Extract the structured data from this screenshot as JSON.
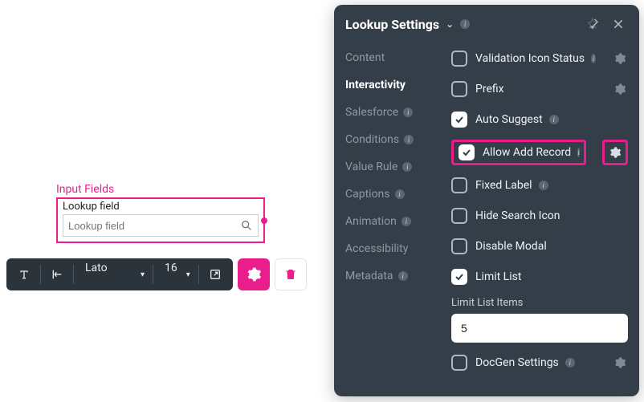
{
  "canvas": {
    "section_label": "Input Fields",
    "lookup_title": "Lookup field",
    "lookup_placeholder": "Lookup field"
  },
  "toolbar": {
    "font_family": "Lato",
    "font_size": "16"
  },
  "panel": {
    "title": "Lookup Settings",
    "tabs": [
      {
        "label": "Content",
        "active": false,
        "info": false
      },
      {
        "label": "Interactivity",
        "active": true,
        "info": false
      },
      {
        "label": "Salesforce",
        "active": false,
        "info": true
      },
      {
        "label": "Conditions",
        "active": false,
        "info": true
      },
      {
        "label": "Value Rule",
        "active": false,
        "info": true
      },
      {
        "label": "Captions",
        "active": false,
        "info": true
      },
      {
        "label": "Animation",
        "active": false,
        "info": true
      },
      {
        "label": "Accessibility",
        "active": false,
        "info": false
      },
      {
        "label": "Metadata",
        "active": false,
        "info": true
      }
    ],
    "options": [
      {
        "label": "Validation Icon Status",
        "checked": false,
        "info": true,
        "gear": true,
        "highlight": false
      },
      {
        "label": "Prefix",
        "checked": false,
        "info": false,
        "gear": true,
        "highlight": false
      },
      {
        "label": "Auto Suggest",
        "checked": true,
        "info": true,
        "gear": false,
        "highlight": false
      },
      {
        "label": "Allow Add Record",
        "checked": true,
        "info": true,
        "gear": true,
        "highlight": true
      },
      {
        "label": "Fixed Label",
        "checked": false,
        "info": true,
        "gear": false,
        "highlight": false
      },
      {
        "label": "Hide Search Icon",
        "checked": false,
        "info": false,
        "gear": false,
        "highlight": false
      },
      {
        "label": "Disable Modal",
        "checked": false,
        "info": false,
        "gear": false,
        "highlight": false
      },
      {
        "label": "Limit List",
        "checked": true,
        "info": false,
        "gear": false,
        "highlight": false
      }
    ],
    "limit_list_label": "Limit List Items",
    "limit_list_value": "5",
    "docgen": {
      "label": "DocGen Settings",
      "checked": false,
      "info": true,
      "gear": true
    }
  }
}
